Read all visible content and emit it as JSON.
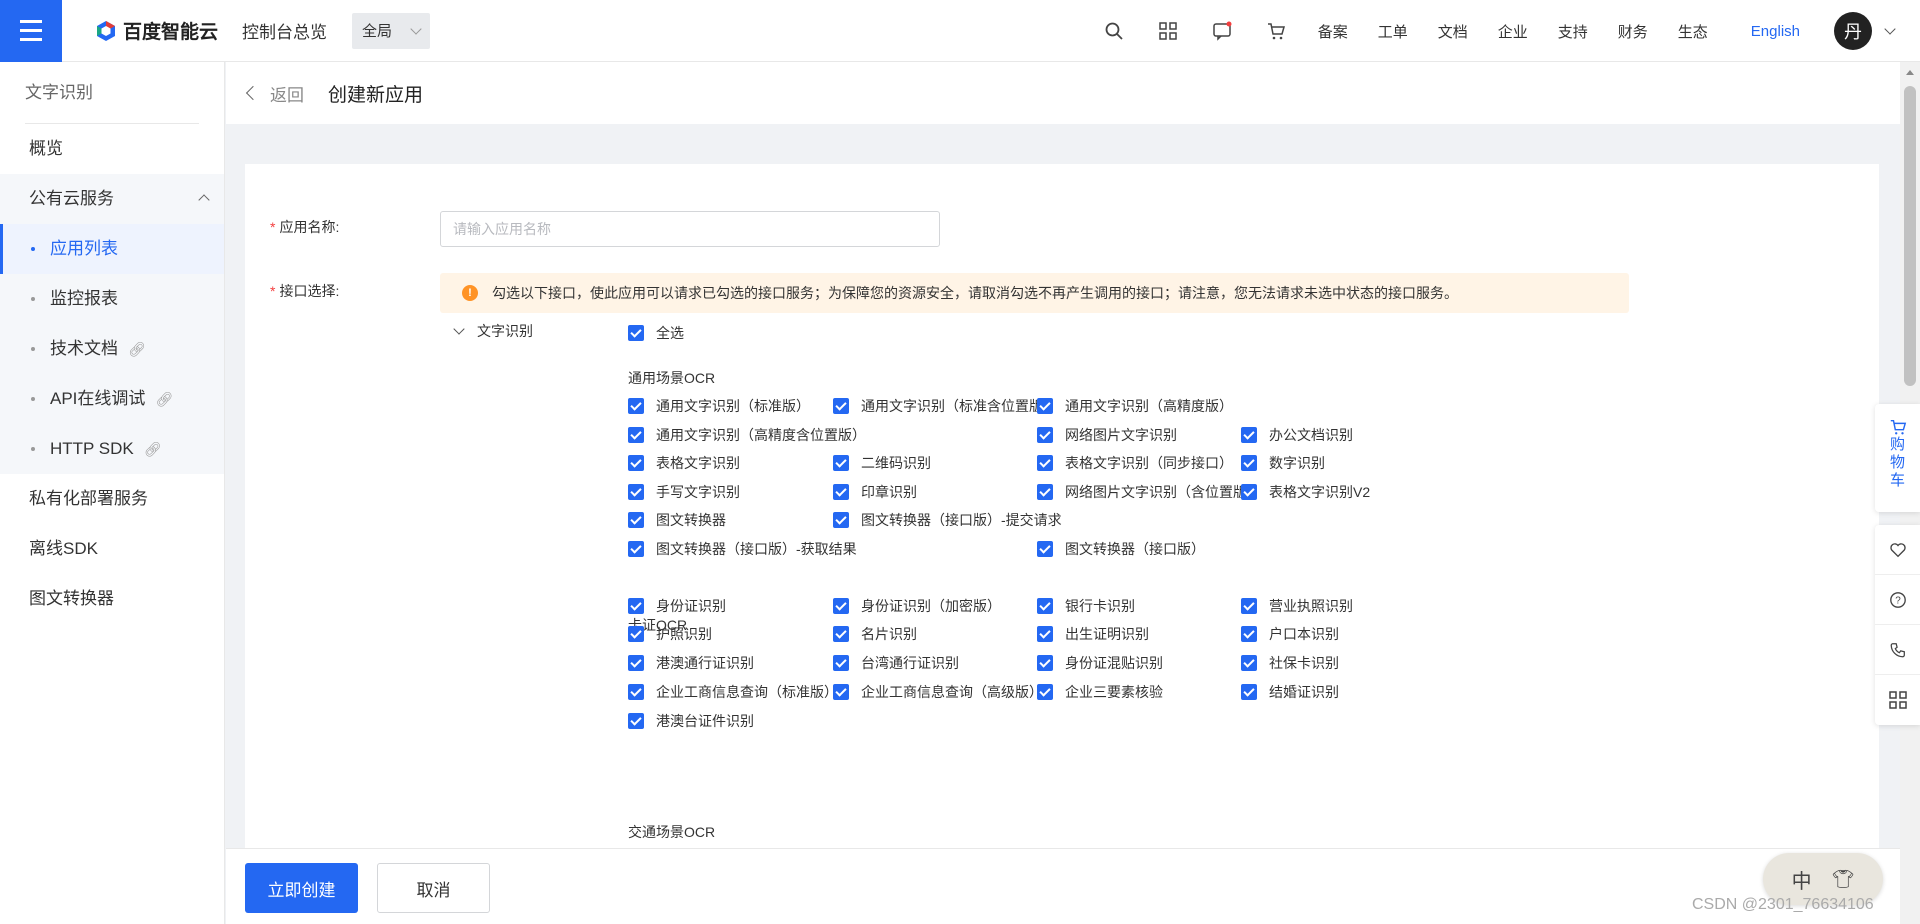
{
  "topbar": {
    "brand": "百度智能云",
    "console": "控制台总览",
    "scope": "全局",
    "links": [
      "备案",
      "工单",
      "文档",
      "企业",
      "支持",
      "财务",
      "生态"
    ],
    "language": "English",
    "avatar_initial": "丹"
  },
  "sidebar": {
    "title": "文字识别",
    "overview": "概览",
    "group": "公有云服务",
    "sub_items": [
      "应用列表",
      "监控报表",
      "技术文档",
      "API在线调试",
      "HTTP SDK"
    ],
    "items_after": [
      "私有化部署服务",
      "离线SDK",
      "图文转换器"
    ]
  },
  "header": {
    "back": "返回",
    "title": "创建新应用"
  },
  "form": {
    "app_name_label": "应用名称:",
    "app_name_placeholder": "请输入应用名称",
    "api_label": "接口选择:",
    "notice": "勾选以下接口，使此应用可以请求已勾选的接口服务；为保障您的资源安全，请取消勾选不再产生调用的接口；请注意，您无法请求未选中状态的接口服务。",
    "group_name": "文字识别",
    "select_all": "全选",
    "sections": {
      "general": "通用场景OCR",
      "card": "卡证OCR",
      "traffic": "交通场景OCR"
    },
    "general_items": [
      "通用文字识别（标准版）",
      "通用文字识别（标准含位置版）",
      "通用文字识别（高精度版）",
      "通用文字识别（高精度含位置版）",
      "网络图片文字识别",
      "办公文档识别",
      "表格文字识别",
      "二维码识别",
      "表格文字识别（同步接口）",
      "数字识别",
      "手写文字识别",
      "印章识别",
      "网络图片文字识别（含位置版）",
      "表格文字识别V2",
      "图文转换器",
      "图文转换器（接口版）-提交请求",
      "图文转换器（接口版）-获取结果",
      "图文转换器（接口版）"
    ],
    "card_items": [
      "身份证识别",
      "身份证识别（加密版）",
      "银行卡识别",
      "营业执照识别",
      "护照识别",
      "名片识别",
      "出生证明识别",
      "户口本识别",
      "港澳通行证识别",
      "台湾通行证识别",
      "身份证混贴识别",
      "社保卡识别",
      "企业工商信息查询（标准版）",
      "企业工商信息查询（高级版）",
      "企业三要素核验",
      "结婚证识别",
      "港澳台证件识别"
    ]
  },
  "footer": {
    "create": "立即创建",
    "cancel": "取消"
  },
  "float": {
    "cart": [
      "购",
      "物",
      "车"
    ]
  },
  "ime": {
    "mode": "中"
  },
  "watermark": "CSDN @2301_76634106"
}
